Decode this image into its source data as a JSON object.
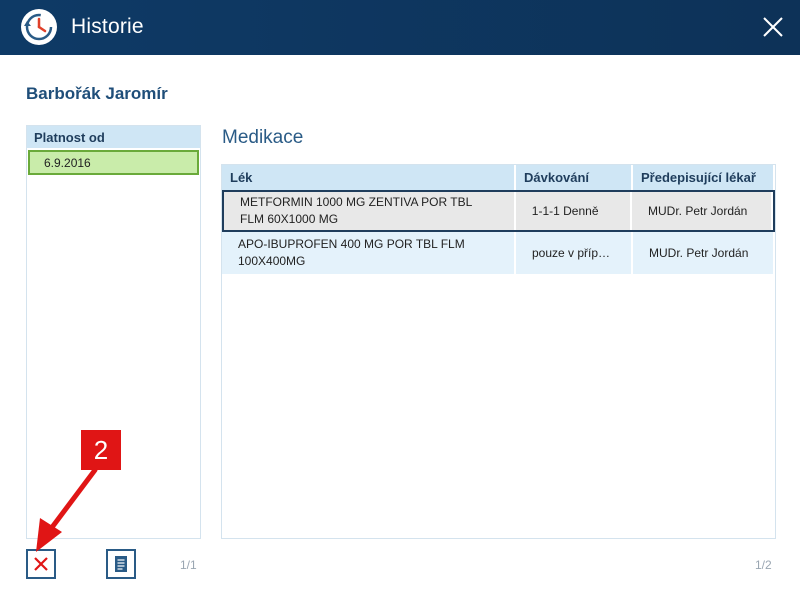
{
  "window": {
    "title": "Historie"
  },
  "patient": {
    "name": "Barbořák Jaromír"
  },
  "validity": {
    "header": "Platnost od",
    "items": [
      {
        "date": "6.9.2016",
        "selected": true
      }
    ],
    "pager": "1/1"
  },
  "medication": {
    "title": "Medikace",
    "columns": [
      "Lék",
      "Dávkování",
      "Předepisující lékař"
    ],
    "rows": [
      {
        "drug_line1": "METFORMIN 1000 MG ZENTIVA POR TBL",
        "drug_line2": "FLM 60X1000 MG",
        "dosage": "1-1-1 Denně",
        "doctor": "MUDr. Petr Jordán",
        "selected": true
      },
      {
        "drug_line1": "APO-IBUPROFEN 400 MG POR TBL FLM",
        "drug_line2": "100X400MG",
        "dosage": "pouze v příp…",
        "doctor": "MUDr. Petr Jordán",
        "selected": false
      }
    ],
    "pager": "1/2"
  },
  "annotation": {
    "step": "2",
    "color": "#e01515"
  },
  "icons": {
    "app": "clock-history-icon",
    "close": "close-icon",
    "delete": "x-icon",
    "document": "document-icon"
  },
  "colors": {
    "titlebar": "#0e3a66",
    "accent": "#2a5b86",
    "header_bg": "#cfe6f5",
    "selected_date": "#c9ecaa"
  }
}
